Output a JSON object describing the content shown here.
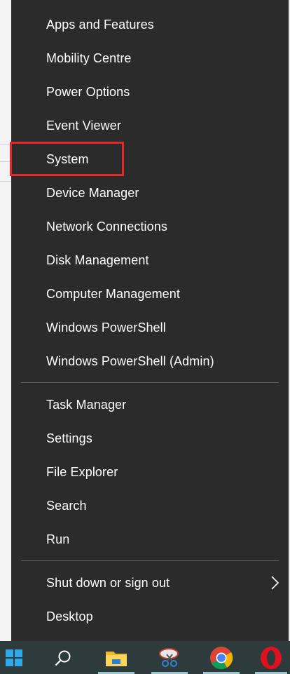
{
  "menu": {
    "items": [
      {
        "label": "Apps and Features"
      },
      {
        "label": "Mobility Centre"
      },
      {
        "label": "Power Options"
      },
      {
        "label": "Event Viewer"
      },
      {
        "label": "System"
      },
      {
        "label": "Device Manager"
      },
      {
        "label": "Network Connections"
      },
      {
        "label": "Disk Management"
      },
      {
        "label": "Computer Management"
      },
      {
        "label": "Windows PowerShell"
      },
      {
        "label": "Windows PowerShell (Admin)"
      }
    ],
    "items2": [
      {
        "label": "Task Manager"
      },
      {
        "label": "Settings"
      },
      {
        "label": "File Explorer"
      },
      {
        "label": "Search"
      },
      {
        "label": "Run"
      }
    ],
    "items3": [
      {
        "label": "Shut down or sign out"
      },
      {
        "label": "Desktop"
      }
    ],
    "highlighted_item": "System",
    "highlight_color": "#e3272b",
    "background_color": "#2b2b2b"
  },
  "taskbar": {
    "icons": [
      "windows-start-icon",
      "search-icon",
      "file-explorer-icon",
      "snipping-tool-icon",
      "chrome-icon",
      "opera-icon"
    ],
    "background_color": "#2d3b3d"
  }
}
